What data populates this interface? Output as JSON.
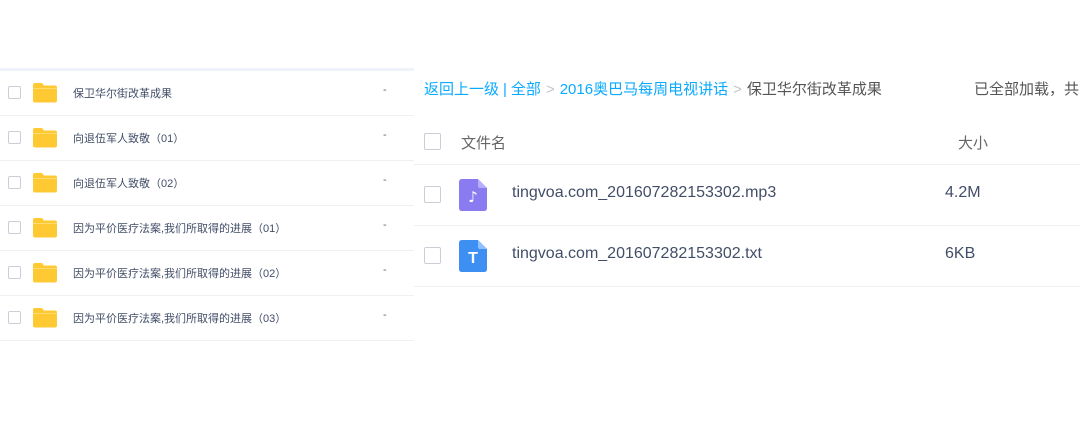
{
  "left_list": {
    "items": [
      {
        "name": "保卫华尔街改革成果",
        "size": "-"
      },
      {
        "name": "向退伍军人致敬（01）",
        "size": "-"
      },
      {
        "name": "向退伍军人致敬（02）",
        "size": "-"
      },
      {
        "name": "因为平价医疗法案,我们所取得的进展（01）",
        "size": "-"
      },
      {
        "name": "因为平价医疗法案,我们所取得的进展（02）",
        "size": "-"
      },
      {
        "name": "因为平价医疗法案,我们所取得的进展（03）",
        "size": "-"
      }
    ]
  },
  "breadcrumb": {
    "back": "返回上一级",
    "all": "全部",
    "folder": "2016奥巴马每周电视讲话",
    "current": "保卫华尔街改革成果",
    "separator": ">",
    "bar": "|"
  },
  "status": {
    "text": "已全部加载，共"
  },
  "file_table": {
    "header_name": "文件名",
    "header_size": "大小",
    "rows": [
      {
        "name": "tingvoa.com_201607282153302.mp3",
        "size": "4.2M",
        "icon": "audio-file-icon",
        "icon_glyph": "♪"
      },
      {
        "name": "tingvoa.com_201607282153302.txt",
        "size": "6KB",
        "icon": "text-file-icon",
        "icon_glyph": "T"
      }
    ]
  },
  "colors": {
    "link": "#09aaff",
    "folder": "#ffc933",
    "audio_icon": "#8a7cf0",
    "text_icon": "#3d8ff2"
  }
}
